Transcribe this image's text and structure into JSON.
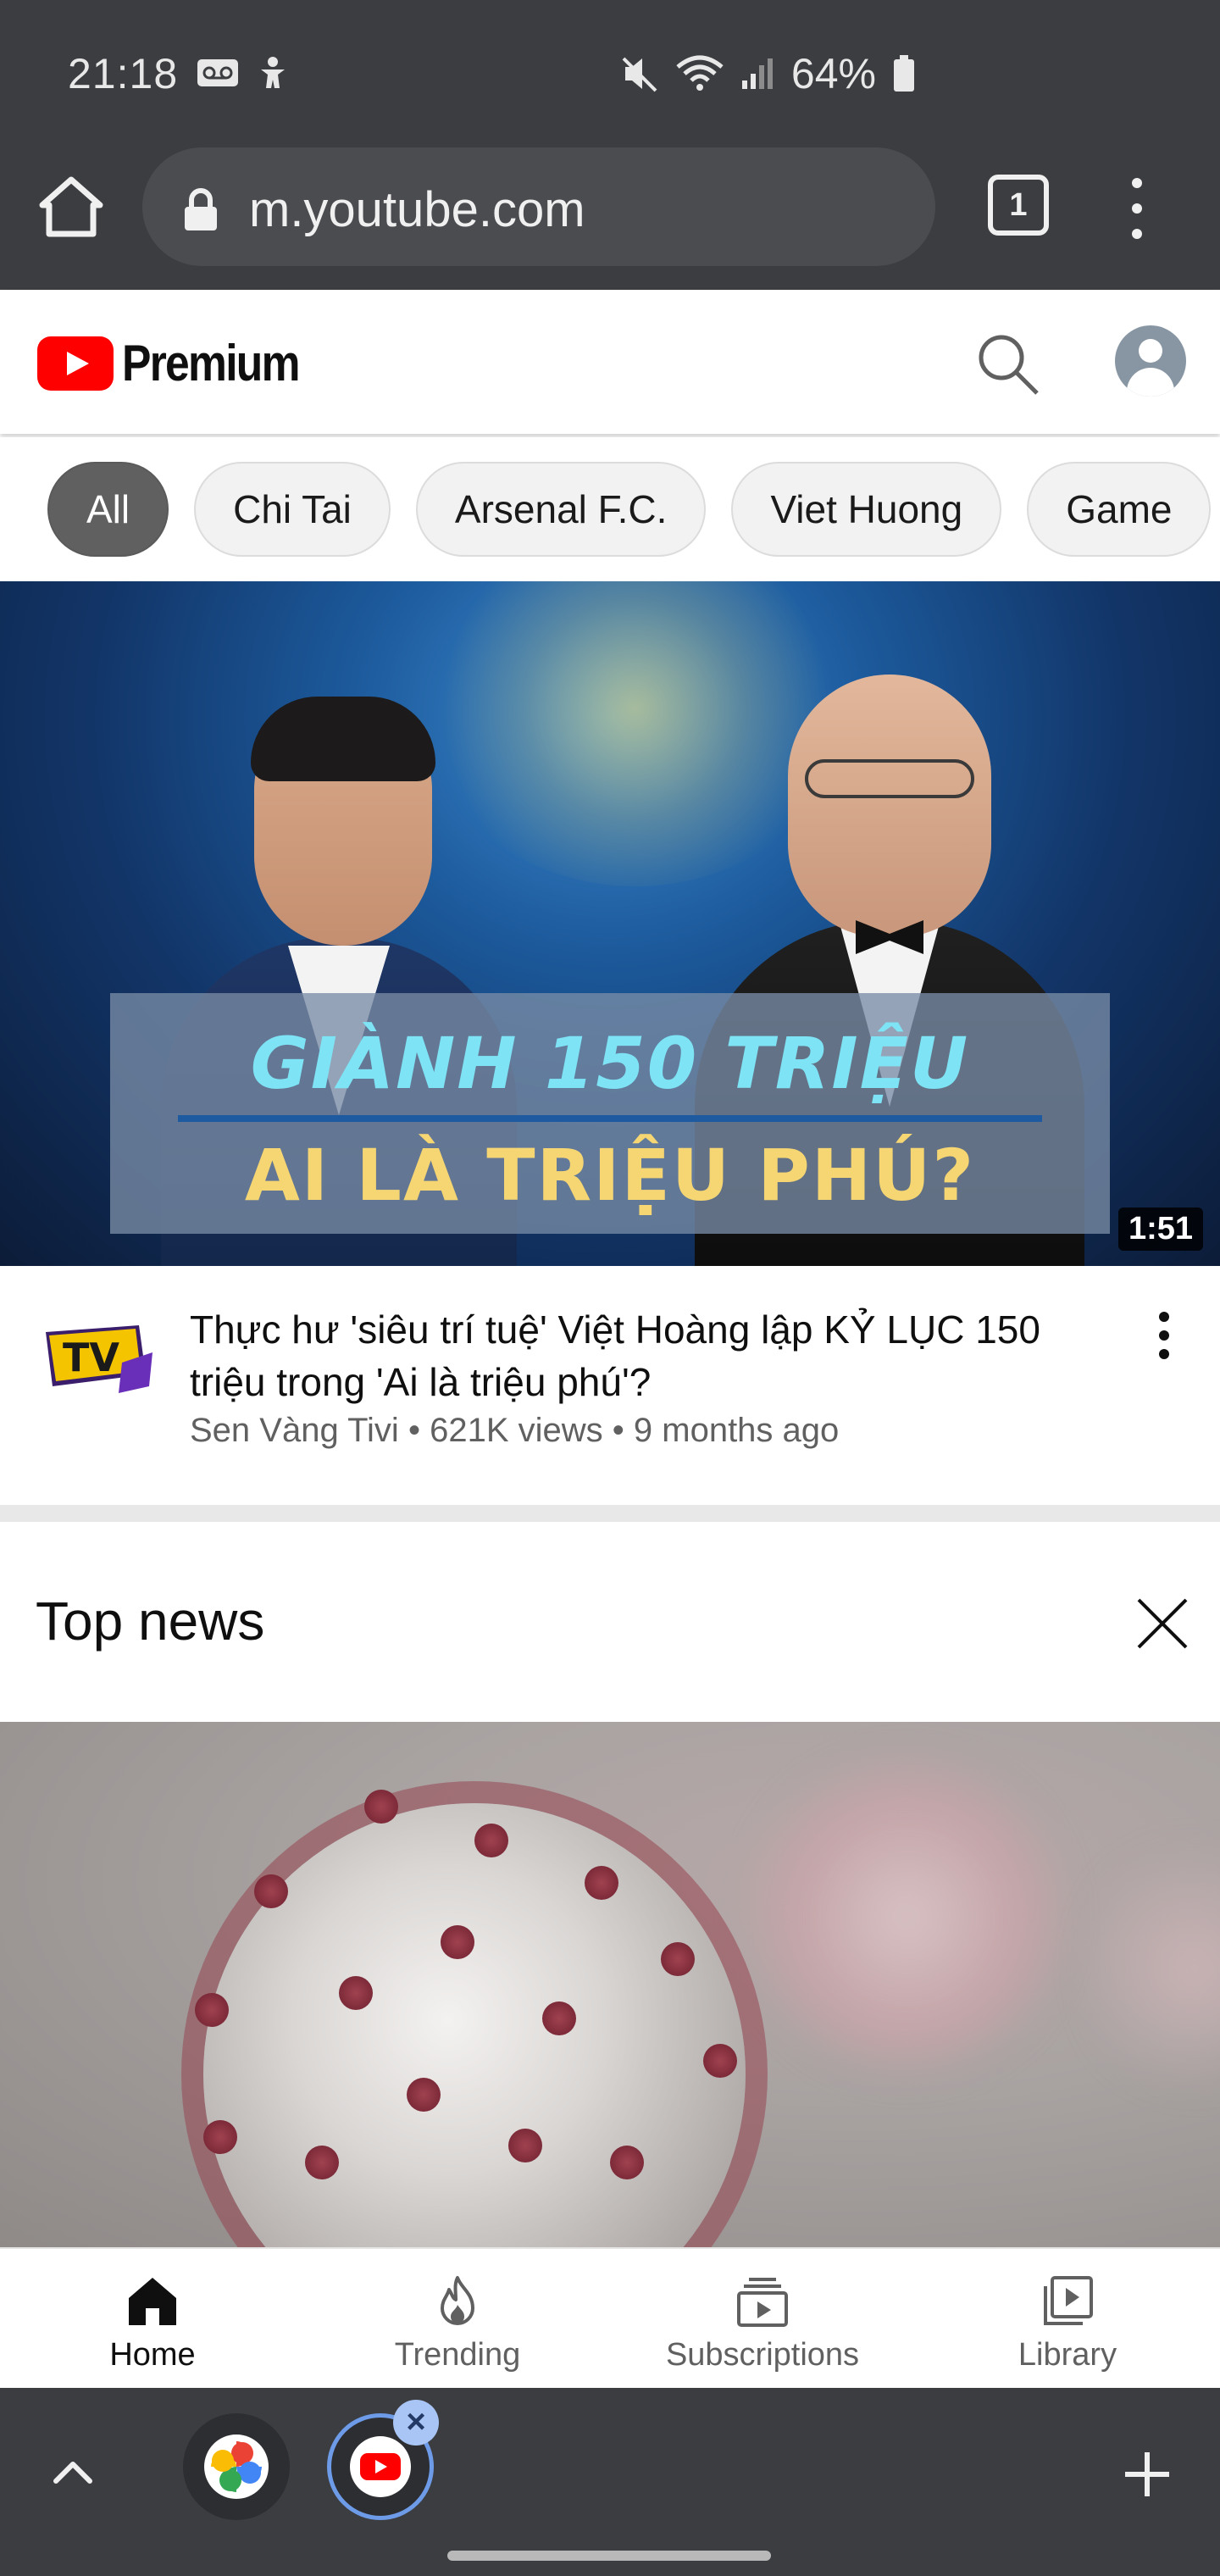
{
  "status_bar": {
    "time": "21:18",
    "battery": "64%",
    "left_icons": [
      "voicemail-icon",
      "accessibility-icon"
    ],
    "right_icons": [
      "mute-icon",
      "wifi-icon",
      "signal-icon",
      "battery-icon"
    ]
  },
  "browser": {
    "url": "m.youtube.com",
    "tab_count": "1"
  },
  "youtube": {
    "logo_text": "Premium",
    "chips": [
      "All",
      "Chi Tai",
      "Arsenal F.C.",
      "Viet Huong",
      "Game"
    ],
    "active_chip": "All"
  },
  "video1": {
    "thumbnail_text_line1": "GIÀNH 150 TRIỆU",
    "thumbnail_text_line2": "AI LÀ TRIỆU PHÚ?",
    "duration": "1:51",
    "title": "Thực hư 'siêu trí tuệ' Việt Hoàng lập KỶ LỤC 150 triệu trong 'Ai là triệu phú'?",
    "channel": "Sen Vàng Tivi",
    "views": "621K views",
    "age": "9 months ago",
    "channel_logo_text": "TV"
  },
  "top_news": {
    "title": "Top news"
  },
  "bottom_nav": [
    {
      "label": "Home",
      "icon": "home-icon",
      "active": true
    },
    {
      "label": "Trending",
      "icon": "trending-flame-icon",
      "active": false
    },
    {
      "label": "Subscriptions",
      "icon": "subscriptions-icon",
      "active": false
    },
    {
      "label": "Library",
      "icon": "library-icon",
      "active": false
    }
  ],
  "colors": {
    "youtube_red": "#ff0000",
    "system_bar": "#3b3d40",
    "active_chip": "#606060",
    "dock_highlight": "#6d9be8"
  }
}
